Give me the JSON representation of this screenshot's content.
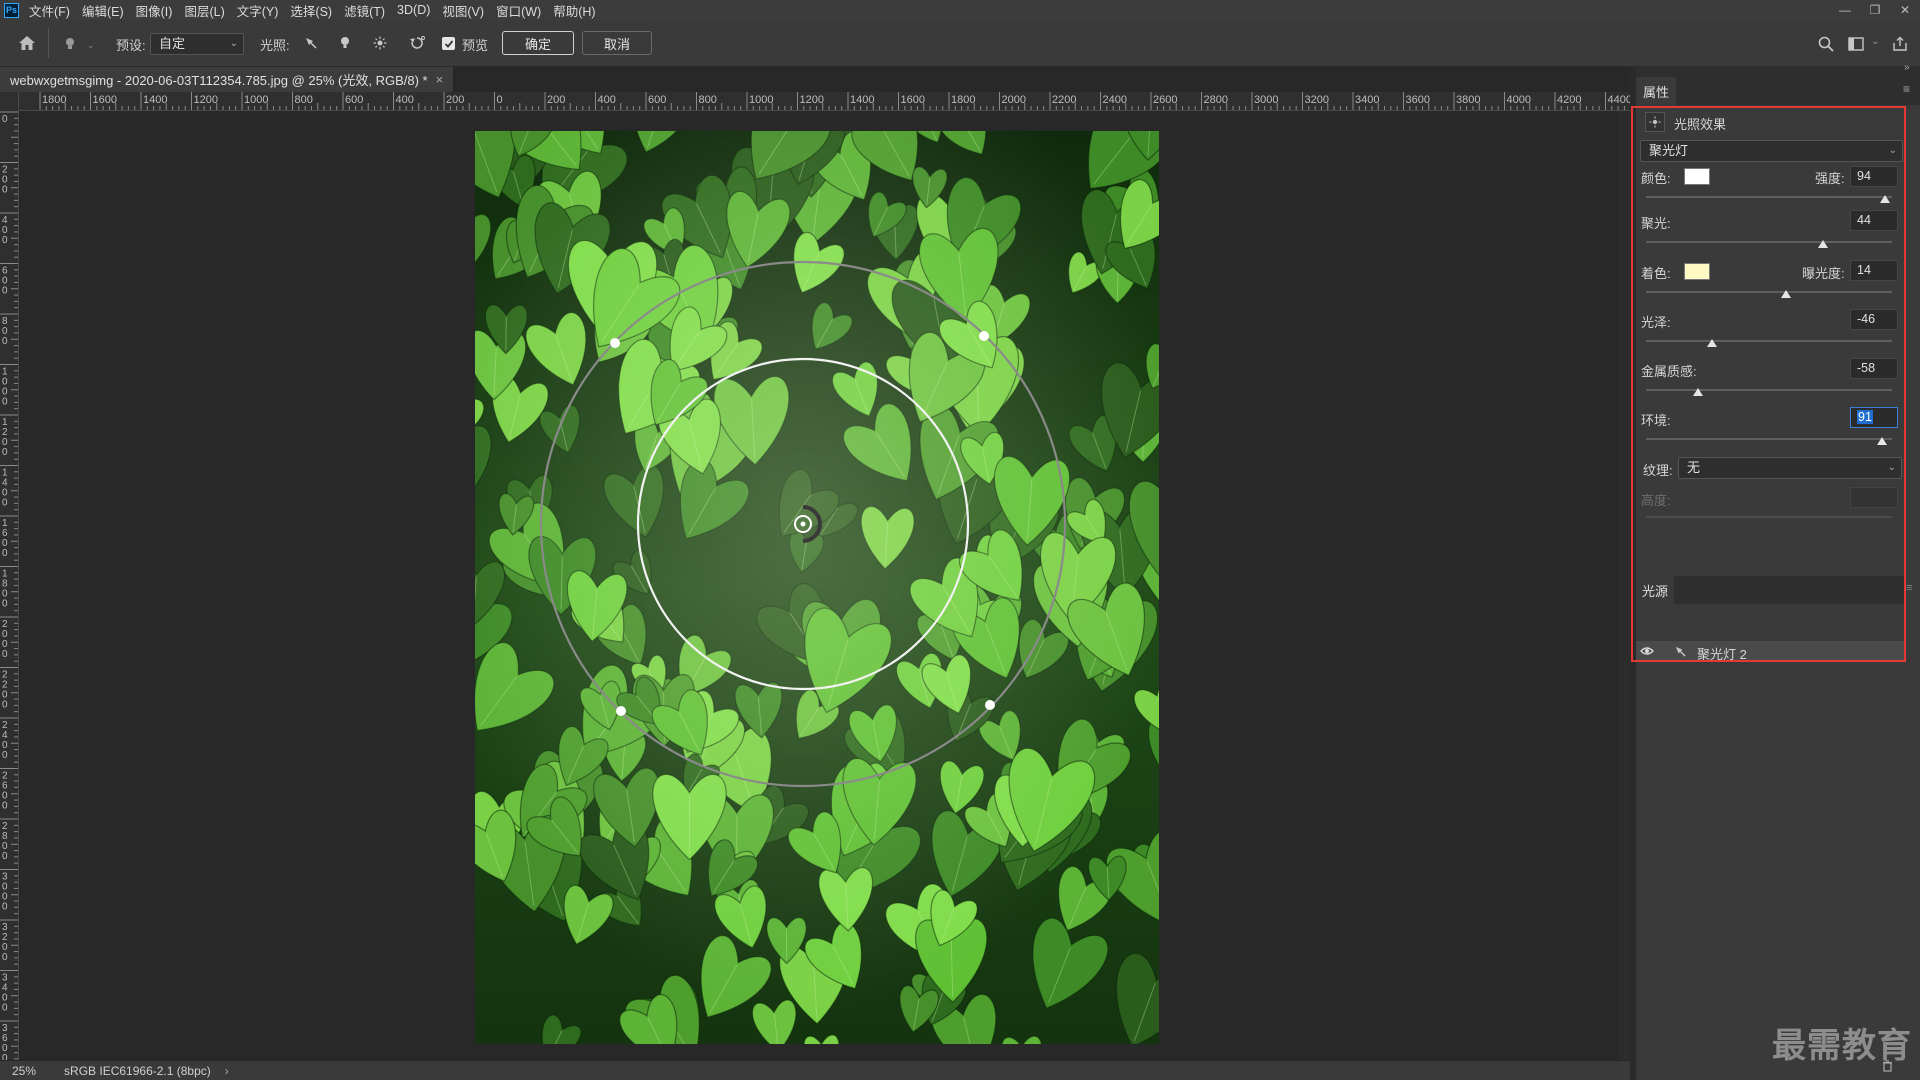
{
  "app": {
    "logo": "Ps"
  },
  "menu": [
    "文件(F)",
    "编辑(E)",
    "图像(I)",
    "图层(L)",
    "文字(Y)",
    "选择(S)",
    "滤镜(T)",
    "3D(D)",
    "视图(V)",
    "窗口(W)",
    "帮助(H)"
  ],
  "window_controls": {
    "minimize": "—",
    "restore": "❐",
    "close": "✕"
  },
  "options": {
    "preset_label": "预设:",
    "preset_value": "自定",
    "light_label": "光照:",
    "preview_label": "预览",
    "preview_checked": true,
    "ok_label": "确定",
    "cancel_label": "取消"
  },
  "document": {
    "tab_title": "webwxgetmsgimg - 2020-06-03T112354.785.jpg @ 25% (光效, RGB/8) *",
    "close_glyph": "×"
  },
  "ruler": {
    "h_ticks": [
      "1800",
      "1600",
      "1400",
      "1200",
      "1000",
      "800",
      "600",
      "400",
      "200",
      "0",
      "200",
      "400",
      "600",
      "800",
      "1000",
      "1200",
      "1400",
      "1600",
      "1800",
      "2000",
      "2200",
      "2400",
      "2600",
      "2800",
      "3000",
      "3200",
      "3400",
      "3600",
      "3800",
      "4000",
      "4200",
      "4400"
    ],
    "v_ticks": [
      "0",
      "2\n0\n0",
      "4\n0\n0",
      "6\n0\n0",
      "8\n0\n0",
      "1\n0\n0\n0",
      "1\n2\n0\n0",
      "1\n4\n0\n0",
      "1\n6\n0\n0",
      "1\n8\n0\n0",
      "2\n0\n0\n0",
      "2\n2\n0\n0",
      "2\n4\n0\n0",
      "2\n6\n0\n0",
      "2\n8\n0\n0",
      "3\n0\n0\n0",
      "3\n2\n0\n0",
      "3\n4\n0\n0",
      "3\n6\n0\n0"
    ]
  },
  "status": {
    "zoom": "25%",
    "profile": "sRGB IEC61966-2.1 (8bpc)",
    "arrow": "›"
  },
  "panel": {
    "tab": "属性",
    "effect_title": "光照效果",
    "light_type": "聚光灯",
    "color_label": "颜色:",
    "color_value": "#ffffff",
    "intensity_label": "强度:",
    "intensity": "94",
    "intensity_pct": 0.97,
    "hotspot_label": "聚光:",
    "hotspot": "44",
    "hotspot_pct": 0.72,
    "tint_label": "着色:",
    "tint_value": "#fff9c4",
    "exposure_label": "曝光度:",
    "exposure": "14",
    "exposure_pct": 0.57,
    "gloss_label": "光泽:",
    "gloss": "-46",
    "gloss_pct": 0.27,
    "metallic_label": "金属质感:",
    "metallic": "-58",
    "metallic_pct": 0.21,
    "ambience_label": "环境:",
    "ambience": "91",
    "ambience_pct": 0.96,
    "texture_label": "纹理:",
    "texture_value": "无",
    "height_label": "高度:",
    "lights_tab": "光源",
    "light_item": "聚光灯 2"
  },
  "watermark": "最需教育",
  "colors": {
    "accent_red": "#e53935",
    "leaf_green": "#4caf2e"
  }
}
